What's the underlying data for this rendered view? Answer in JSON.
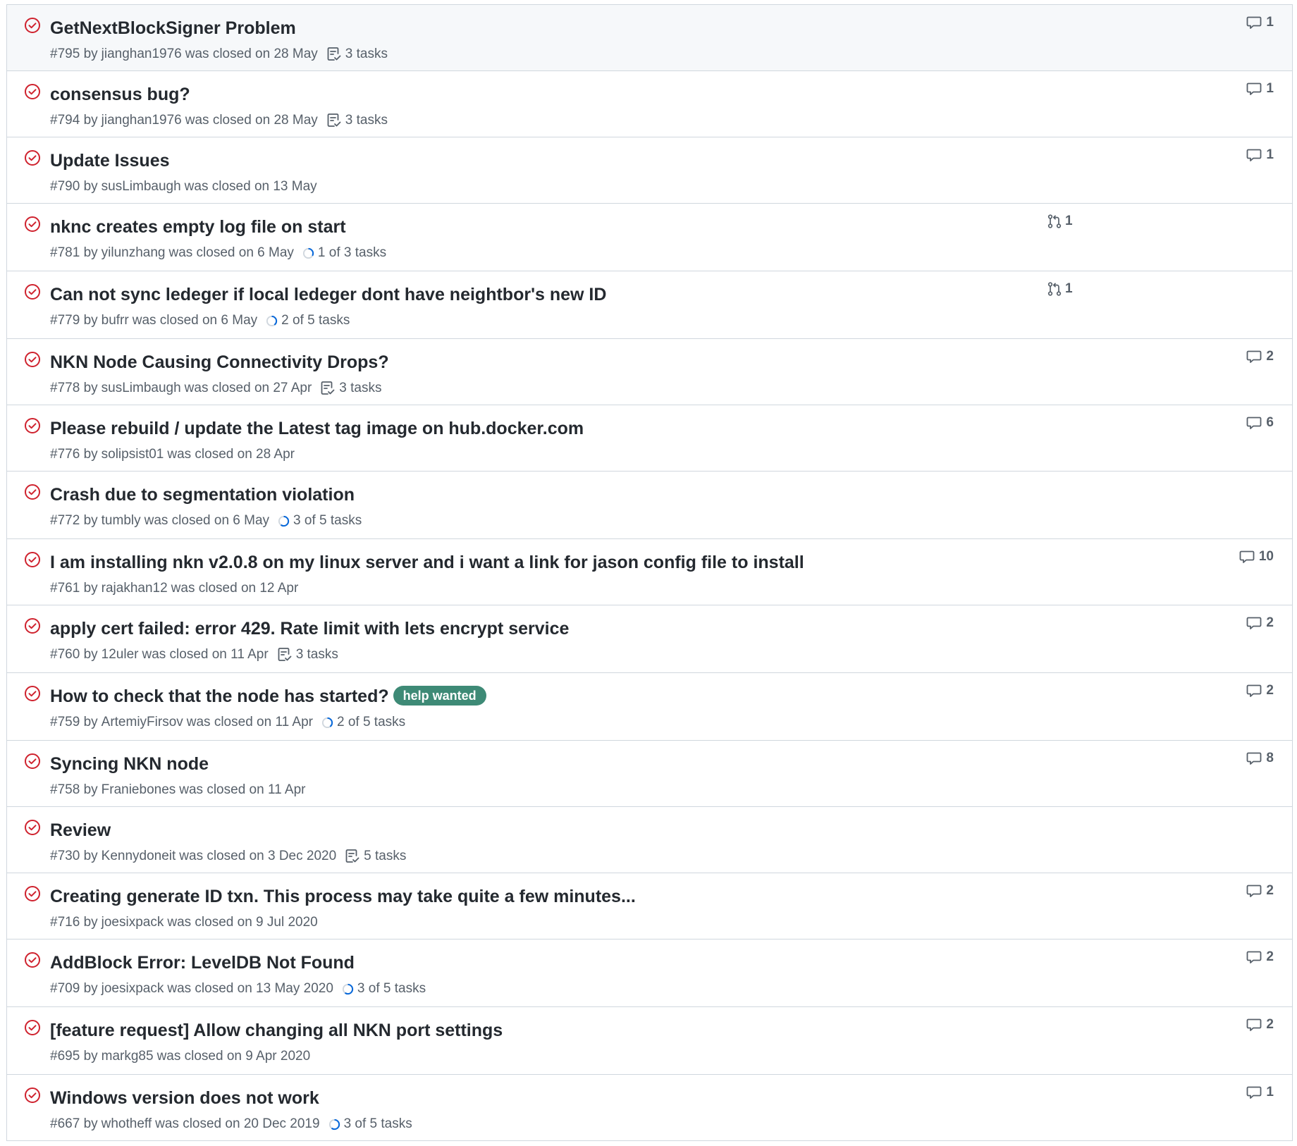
{
  "colors": {
    "closed_icon": "#cf222e",
    "progress_arc": "#0969da",
    "progress_track": "#d0d7de",
    "label_help_wanted": "#3e8a76",
    "meta_text": "#57606a",
    "border": "#d0d7de"
  },
  "icons": {
    "state": "issue-closed-icon",
    "comments": "comment-icon",
    "tasks_checklist": "checklist-icon",
    "tasks_progress": "progress-ring-icon",
    "linked_pr": "pull-request-icon"
  },
  "meta_words": {
    "by": "by",
    "closed_on": "was closed on"
  },
  "issues": [
    {
      "title": "GetNextBlockSigner Problem",
      "number": "#795",
      "author": "jianghan1976",
      "date": "28 May",
      "tasks": "3 tasks",
      "tasks_kind": "checklist",
      "comments": "1"
    },
    {
      "title": "consensus bug?",
      "number": "#794",
      "author": "jianghan1976",
      "date": "28 May",
      "tasks": "3 tasks",
      "tasks_kind": "checklist",
      "comments": "1"
    },
    {
      "title": "Update Issues",
      "number": "#790",
      "author": "susLimbaugh",
      "date": "13 May",
      "comments": "1"
    },
    {
      "title": "nknc creates empty log file on start",
      "number": "#781",
      "author": "yilunzhang",
      "date": "6 May",
      "tasks": "1 of 3 tasks",
      "tasks_kind": "progress",
      "tasks_done": 1,
      "tasks_total": 3,
      "linked_prs": "1"
    },
    {
      "title": "Can not sync ledeger if local ledeger dont have neightbor's new ID",
      "number": "#779",
      "author": "bufrr",
      "date": "6 May",
      "tasks": "2 of 5 tasks",
      "tasks_kind": "progress",
      "tasks_done": 2,
      "tasks_total": 5,
      "linked_prs": "1"
    },
    {
      "title": "NKN Node Causing Connectivity Drops?",
      "number": "#778",
      "author": "susLimbaugh",
      "date": "27 Apr",
      "tasks": "3 tasks",
      "tasks_kind": "checklist",
      "comments": "2"
    },
    {
      "title": "Please rebuild / update the Latest tag image on hub.docker.com",
      "number": "#776",
      "author": "solipsist01",
      "date": "28 Apr",
      "comments": "6"
    },
    {
      "title": "Crash due to segmentation violation",
      "number": "#772",
      "author": "tumbly",
      "date": "6 May",
      "tasks": "3 of 5 tasks",
      "tasks_kind": "progress",
      "tasks_done": 3,
      "tasks_total": 5
    },
    {
      "title": "I am installing nkn v2.0.8 on my linux server and i want a link for jason config file to install",
      "number": "#761",
      "author": "rajakhan12",
      "date": "12 Apr",
      "comments": "10"
    },
    {
      "title": "apply cert failed: error 429. Rate limit with lets encrypt service",
      "number": "#760",
      "author": "12uler",
      "date": "11 Apr",
      "tasks": "3 tasks",
      "tasks_kind": "checklist",
      "comments": "2"
    },
    {
      "title": "How to check that the node has started?",
      "label": "help wanted",
      "number": "#759",
      "author": "ArtemiyFirsov",
      "date": "11 Apr",
      "tasks": "2 of 5 tasks",
      "tasks_kind": "progress",
      "tasks_done": 2,
      "tasks_total": 5,
      "comments": "2"
    },
    {
      "title": "Syncing NKN node",
      "number": "#758",
      "author": "Franiebones",
      "date": "11 Apr",
      "comments": "8"
    },
    {
      "title": "Review",
      "number": "#730",
      "author": "Kennydoneit",
      "date": "3 Dec 2020",
      "tasks": "5 tasks",
      "tasks_kind": "checklist"
    },
    {
      "title": "Creating generate ID txn. This process may take quite a few minutes...",
      "number": "#716",
      "author": "joesixpack",
      "date": "9 Jul 2020",
      "comments": "2"
    },
    {
      "title": "AddBlock Error: LevelDB Not Found",
      "number": "#709",
      "author": "joesixpack",
      "date": "13 May 2020",
      "tasks": "3 of 5 tasks",
      "tasks_kind": "progress",
      "tasks_done": 3,
      "tasks_total": 5,
      "comments": "2"
    },
    {
      "title": "[feature request] Allow changing all NKN port settings",
      "number": "#695",
      "author": "markg85",
      "date": "9 Apr 2020",
      "comments": "2"
    },
    {
      "title": "Windows version does not work",
      "number": "#667",
      "author": "whotheff",
      "date": "20 Dec 2019",
      "tasks": "3 of 5 tasks",
      "tasks_kind": "progress",
      "tasks_done": 3,
      "tasks_total": 5,
      "comments": "1"
    }
  ]
}
